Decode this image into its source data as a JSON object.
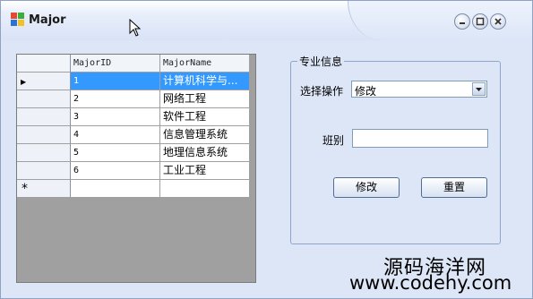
{
  "window": {
    "title": "Major"
  },
  "grid": {
    "columns": [
      "MajorID",
      "MajorName"
    ],
    "rows": [
      {
        "id": "1",
        "name": "计算机科学与..."
      },
      {
        "id": "2",
        "name": "网络工程"
      },
      {
        "id": "3",
        "name": "软件工程"
      },
      {
        "id": "4",
        "name": "信息管理系统"
      },
      {
        "id": "5",
        "name": "地理信息系统"
      },
      {
        "id": "6",
        "name": "工业工程"
      }
    ],
    "current_row_marker": "▶",
    "new_row_marker": "*"
  },
  "panel": {
    "legend": "专业信息",
    "operation_label": "选择操作",
    "operation_value": "修改",
    "class_label": "班别",
    "class_value": "",
    "modify_button": "修改",
    "reset_button": "重置"
  },
  "watermark": {
    "line1": "源码海洋网",
    "line2": "www.codehy.com"
  },
  "colors": {
    "selection": "#3399ff",
    "grid_background": "#a0a0a0",
    "form_background": "#dde6f6"
  }
}
